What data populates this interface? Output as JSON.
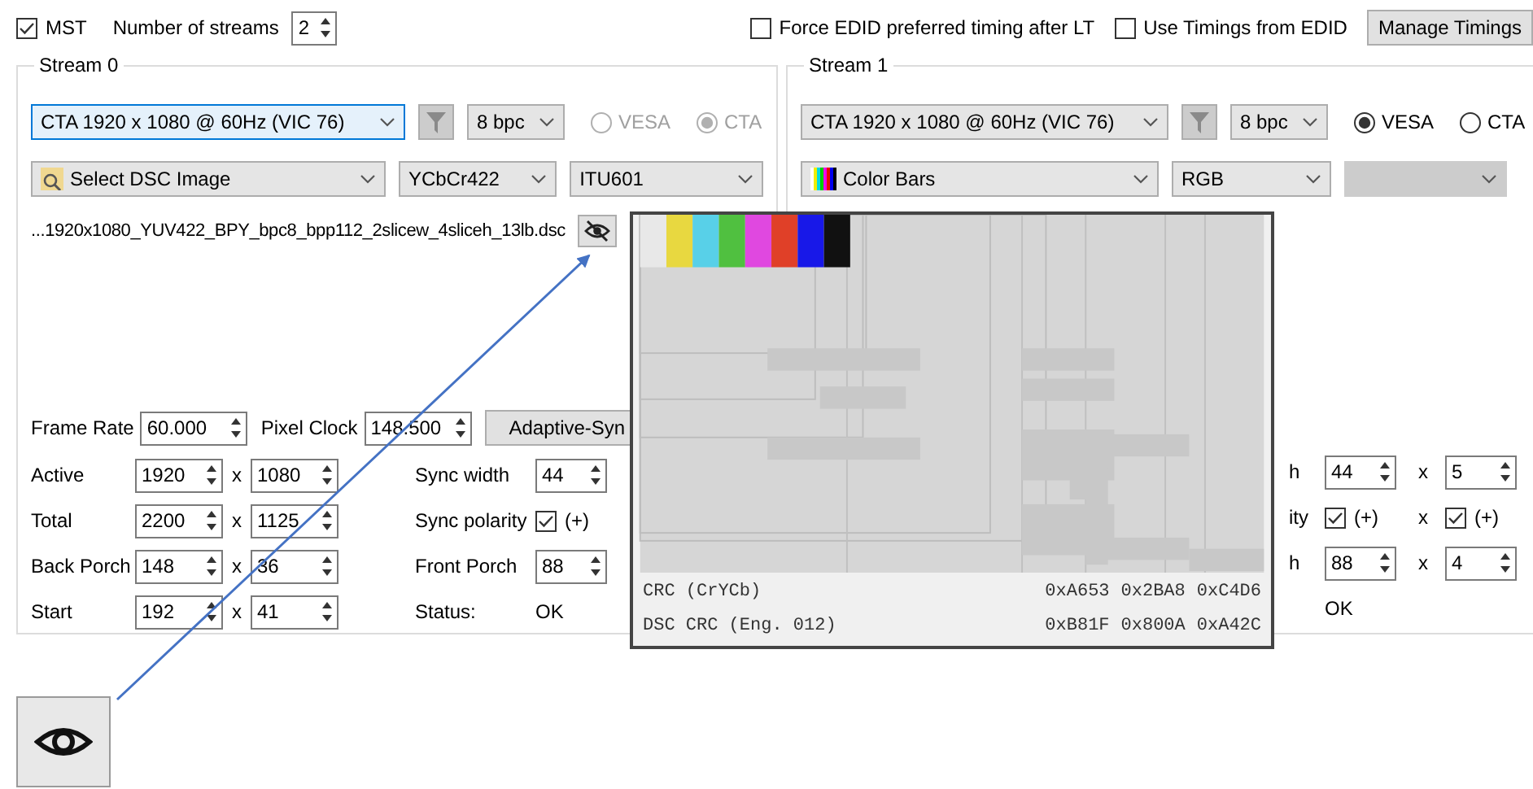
{
  "top_bar": {
    "mst": {
      "label": "MST",
      "checked": true
    },
    "streams_count": {
      "label": "Number of streams",
      "value": "2"
    },
    "options": [
      {
        "label": "Force EDID preferred timing after LT",
        "checked": false
      },
      {
        "label": "Use Timings from EDID",
        "checked": false
      }
    ],
    "manage_button": "Manage Timings"
  },
  "stream_0": {
    "title": "Stream 0",
    "timing": {
      "value": "CTA 1920 x 1080 @ 60Hz (VIC 76)",
      "focused": true
    },
    "bpc": "8 bpc",
    "radios": [
      {
        "label": "VESA",
        "selected": false
      },
      {
        "label": "CTA",
        "selected": true
      }
    ],
    "radios_disabled": true,
    "image": {
      "kind": "dsc",
      "value": "Select DSC Image"
    },
    "color_format": "YCbCr422",
    "colorimetry": {
      "value": "ITU601",
      "disabled": false
    },
    "file_name": "...1920x1080_YUV422_BPY_bpc8_bpp112_2slicew_4sliceh_13lb.dsc",
    "frame_rate": {
      "label": "Frame Rate",
      "value": "60.000"
    },
    "pixel_clock": {
      "label": "Pixel Clock",
      "value": "148.500"
    },
    "adaptive_button": "Adaptive-Syn",
    "geometry": [
      {
        "label": "Active",
        "h": "1920",
        "separator": "x",
        "v": "1080"
      },
      {
        "label": "Total",
        "h": "2200",
        "separator": "x",
        "v": "1125"
      },
      {
        "label": "Back Porch",
        "h": "148",
        "separator": "x",
        "v": "36"
      },
      {
        "label": "Start",
        "h": "192",
        "separator": "x",
        "v": "41"
      }
    ],
    "sync": [
      {
        "kind": "spin",
        "label": "Sync width",
        "value": "44"
      },
      {
        "kind": "check",
        "label": "Sync polarity",
        "checked": true,
        "text": "(+)"
      },
      {
        "kind": "spin",
        "label": "Front Porch",
        "value": "88"
      },
      {
        "kind": "text",
        "label": "Status:",
        "value": "OK"
      }
    ]
  },
  "stream_1": {
    "title": "Stream 1",
    "timing": {
      "value": "CTA 1920 x 1080 @ 60Hz (VIC 76)",
      "focused": false
    },
    "bpc": "8 bpc",
    "radios": [
      {
        "label": "VESA",
        "selected": true
      },
      {
        "label": "CTA",
        "selected": false
      }
    ],
    "radios_disabled": false,
    "image": {
      "kind": "color_bars",
      "value": "Color Bars"
    },
    "color_format": "RGB",
    "colorimetry": {
      "disabled": true
    },
    "sync": [
      {
        "kind": "spin",
        "label": "h",
        "value": "44",
        "separator": "x",
        "value2": "5"
      },
      {
        "kind": "check",
        "label": "ity",
        "checked": true,
        "text": "(+)",
        "separator": "x",
        "checked2": true,
        "text2": "(+)"
      },
      {
        "kind": "spin",
        "label": "h",
        "value": "88",
        "separator": "x",
        "value2": "4"
      },
      {
        "kind": "text",
        "value": "OK"
      }
    ]
  },
  "preview_popup": {
    "crc_rows": [
      {
        "label": "CRC (CrYCb)",
        "values": [
          "0xA653",
          "0x2BA8",
          "0xC4D6"
        ]
      },
      {
        "label": "DSC CRC (Eng. 012)",
        "values": [
          "0xB81F",
          "0x800A",
          "0xA42C"
        ]
      }
    ]
  }
}
